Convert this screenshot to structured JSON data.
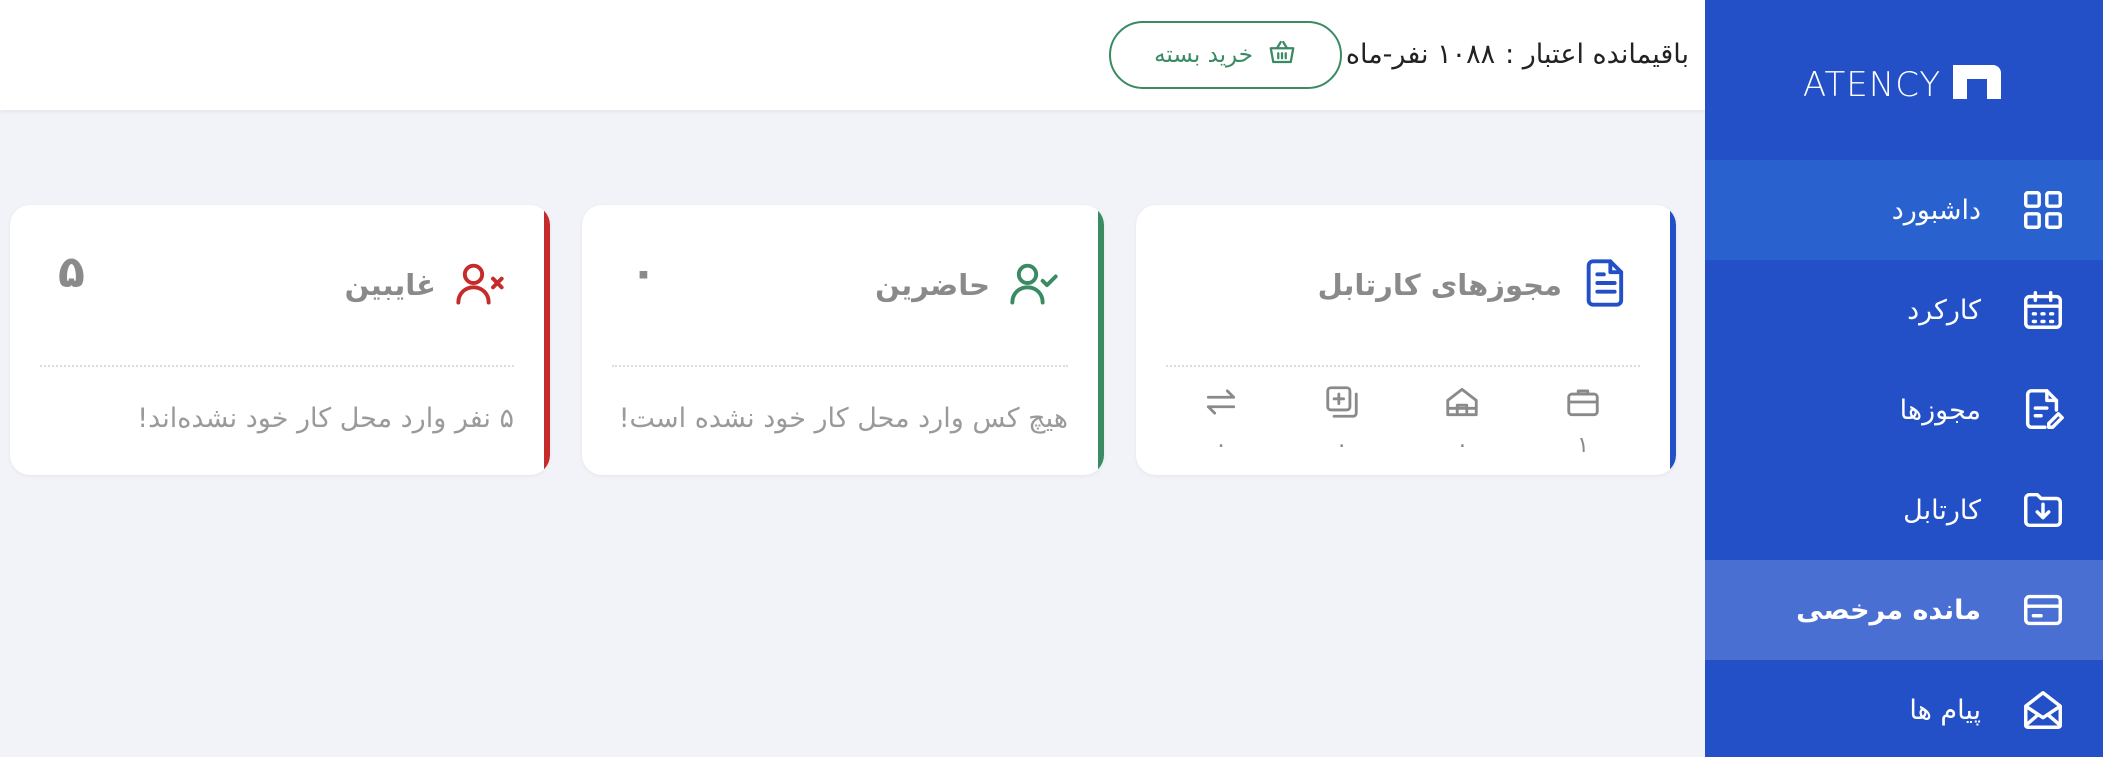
{
  "brand": {
    "name": "ATENCY"
  },
  "header": {
    "credit_label": "باقیمانده اعتبار :",
    "credit_value": "۱۰۸۸ نفر-ماه",
    "buy_button": "خرید بسته"
  },
  "sidebar": {
    "items": [
      {
        "label": "داشبورد",
        "icon": "dashboard-grid-icon"
      },
      {
        "label": "کارکرد",
        "icon": "calendar-icon"
      },
      {
        "label": "مجوزها",
        "icon": "document-edit-icon"
      },
      {
        "label": "کارتابل",
        "icon": "folder-download-icon"
      },
      {
        "label": "مانده مرخصی",
        "icon": "credit-card-icon"
      },
      {
        "label": "پیام ها",
        "icon": "mail-open-icon"
      }
    ]
  },
  "cards": {
    "permits": {
      "title": "مجوزهای کارتابل",
      "stats": [
        "۱",
        "۰",
        "۰",
        "۰"
      ],
      "stat_icons": [
        "briefcase-icon",
        "home-icon",
        "add-copy-icon",
        "swap-arrows-icon"
      ]
    },
    "present": {
      "title": "حاضرین",
      "count": "۰",
      "description": "هیچ کس وارد محل کار خود نشده است!"
    },
    "absent": {
      "title": "غایبین",
      "count": "۵",
      "description": "۵ نفر وارد محل کار خود نشده‌اند!"
    }
  },
  "colors": {
    "sidebar": "#2350c7",
    "primary_blue": "#2350c7",
    "green": "#3a8a63",
    "red": "#c62b2b",
    "background": "#f2f3f9"
  }
}
